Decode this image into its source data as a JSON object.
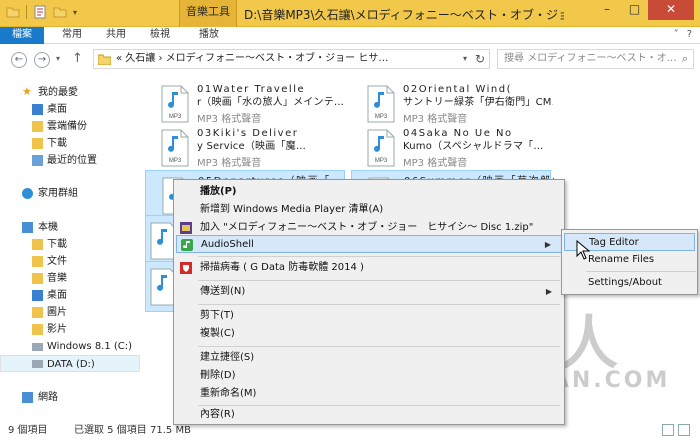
{
  "titlebar": {
    "context_group": "音樂工具",
    "title": "D:\\音樂MP3\\久石讓\\メロディフォニー～ベスト・オブ・ジョー・ヒサイシ～ Disc 1",
    "minimize": "–",
    "maximize": "□",
    "close": "✕"
  },
  "ribbon": {
    "tabs": [
      "檔案",
      "常用",
      "共用",
      "檢視",
      "播放"
    ],
    "right_controls": [
      "˅",
      "?"
    ]
  },
  "address": {
    "path": "« 久石讓 › メロディフォニー～ベスト・オブ・ジョー ヒサ…",
    "search_placeholder": "搜尋 メロディフォニー～ベスト・オ…"
  },
  "sidebar": {
    "items": [
      {
        "label": "我的最愛",
        "icon": "star-icon"
      },
      {
        "label": "桌面",
        "icon": "desktop-icon"
      },
      {
        "label": "雲端備份",
        "icon": "folder-icon"
      },
      {
        "label": "下載",
        "icon": "download-icon"
      },
      {
        "label": "最近的位置",
        "icon": "recent-icon"
      },
      {
        "label": "家用群組",
        "icon": "homegroup-icon"
      },
      {
        "label": "本機",
        "icon": "computer-icon"
      },
      {
        "label": "下載",
        "icon": "download-icon"
      },
      {
        "label": "文件",
        "icon": "documents-icon"
      },
      {
        "label": "音樂",
        "icon": "music-icon"
      },
      {
        "label": "桌面",
        "icon": "desktop-icon"
      },
      {
        "label": "圖片",
        "icon": "pictures-icon"
      },
      {
        "label": "影片",
        "icon": "videos-icon"
      },
      {
        "label": "Windows 8.1 (C:)",
        "icon": "drive-icon"
      },
      {
        "label": "DATA (D:)",
        "icon": "drive-icon"
      },
      {
        "label": "網路",
        "icon": "network-icon"
      }
    ]
  },
  "files": [
    {
      "line1": "01Water Travelle",
      "line2": "r（映画「水の旅人」メインテ…",
      "type": "MP3 格式聲音"
    },
    {
      "line1": "02Oriental Wind(",
      "line2": "サントリー緑茶「伊右衛門」CM…",
      "type": "MP3 格式聲音"
    },
    {
      "line1": "03Kiki's Deliver",
      "line2": "y Service（映画「魔…",
      "type": "MP3 格式聲音"
    },
    {
      "line1": "04Saka No Ue No",
      "line2": "Kumo（スペシャルドラマ「…",
      "type": "MP3 格式聲音"
    },
    {
      "line1": "05Departures（映画「…",
      "line2": "",
      "type": ""
    },
    {
      "line1": "06Summer（映画「菊次郎の…",
      "line2": "",
      "type": ""
    }
  ],
  "file_icon_label": "MP3",
  "status": {
    "count": "9 個項目",
    "selected": "已選取 5 個項目",
    "size": "71.5 MB"
  },
  "watermark": {
    "text": "重灌狂人",
    "url": "HTTP://BRIAN.COM"
  },
  "context_menu": {
    "items": [
      {
        "label": "播放(P)",
        "icon": ""
      },
      {
        "label": "新增到 Windows Media Player 清單(A)",
        "icon": ""
      },
      {
        "label": "加入 \"メロディフォニー～ベスト・オブ・ジョー　ヒサイシ～ Disc 1.zip\"",
        "icon": "winrar-icon"
      },
      {
        "label": "AudioShell",
        "icon": "audioshell-icon",
        "submenu": true
      },
      {
        "label": "掃描病毒 ( G Data 防毒軟體 2014 )",
        "icon": "gdata-shield-icon"
      },
      {
        "label": "傳送到(N)",
        "icon": "",
        "submenu": true
      },
      {
        "label": "剪下(T)",
        "icon": ""
      },
      {
        "label": "複製(C)",
        "icon": ""
      },
      {
        "label": "建立捷徑(S)",
        "icon": ""
      },
      {
        "label": "刪除(D)",
        "icon": ""
      },
      {
        "label": "重新命名(M)",
        "icon": ""
      },
      {
        "label": "內容(R)",
        "icon": ""
      }
    ],
    "submenu_arrow": "▶"
  },
  "submenu": {
    "items": [
      "Tag Editor",
      "Rename Files",
      "Settings/About"
    ]
  },
  "colors": {
    "titlebar": "#f2c84b",
    "file_tab": "#1979ca",
    "selection": "#cce8ff",
    "menu_hot": "#d5e7f8"
  }
}
